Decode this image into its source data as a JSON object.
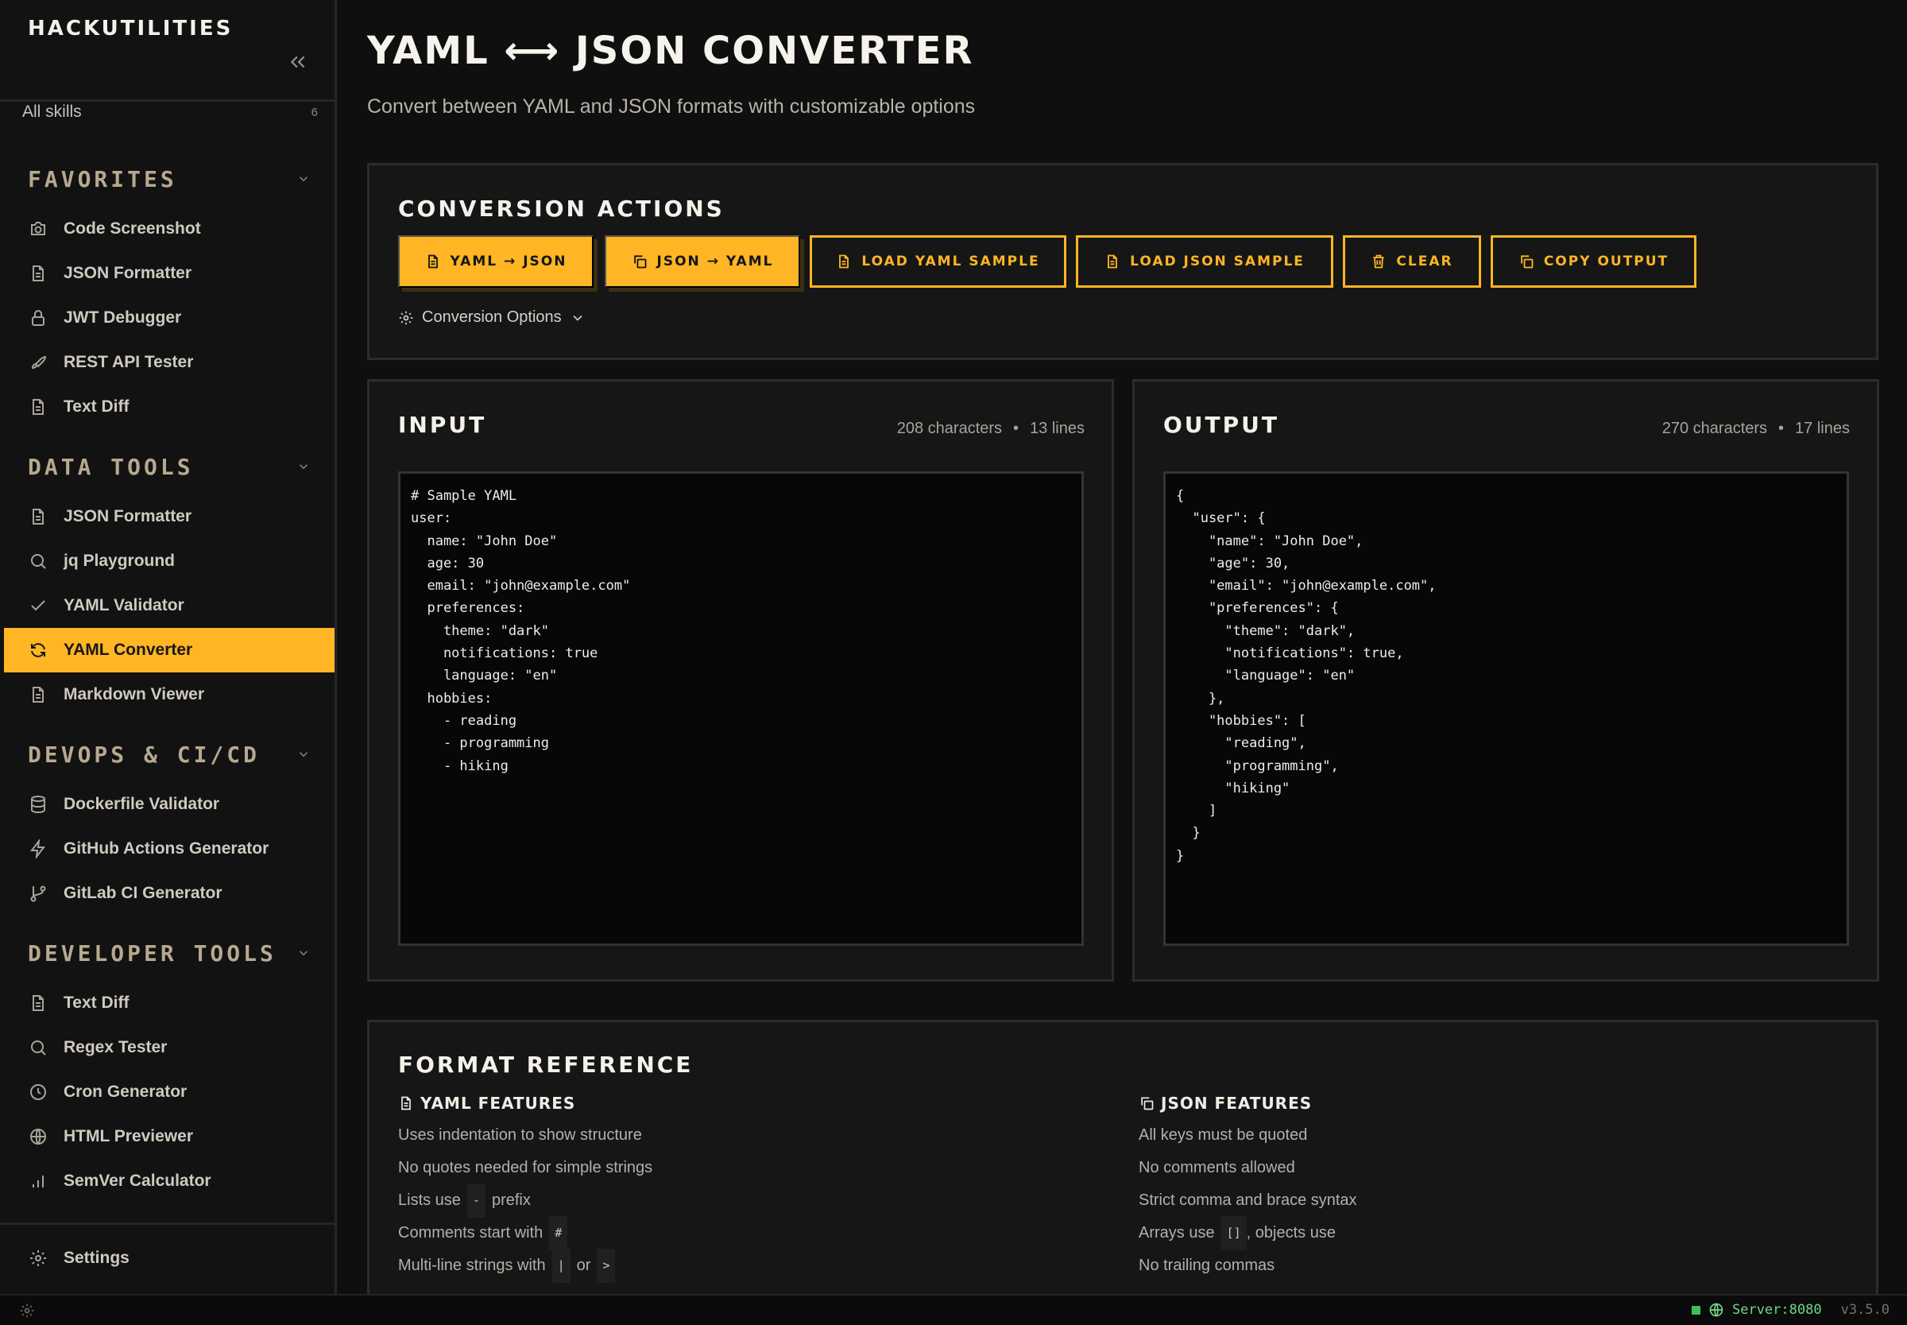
{
  "sidebar": {
    "brand": "HACKUTILITIES",
    "all_skills": {
      "label": "All skills",
      "count": "6"
    },
    "sections": [
      {
        "title": "FAVORITES",
        "items": [
          {
            "label": "Code Screenshot",
            "icon": "camera-icon"
          },
          {
            "label": "JSON Formatter",
            "icon": "document-icon"
          },
          {
            "label": "JWT Debugger",
            "icon": "lock-icon"
          },
          {
            "label": "REST API Tester",
            "icon": "rocket-icon"
          },
          {
            "label": "Text Diff",
            "icon": "document-icon"
          }
        ]
      },
      {
        "title": "DATA TOOLS",
        "items": [
          {
            "label": "JSON Formatter",
            "icon": "document-icon"
          },
          {
            "label": "jq Playground",
            "icon": "search-icon"
          },
          {
            "label": "YAML Validator",
            "icon": "check-icon"
          },
          {
            "label": "YAML Converter",
            "icon": "refresh-icon",
            "active": true
          },
          {
            "label": "Markdown Viewer",
            "icon": "document-icon"
          }
        ]
      },
      {
        "title": "DEVOPS & CI/CD",
        "items": [
          {
            "label": "Dockerfile Validator",
            "icon": "database-icon"
          },
          {
            "label": "GitHub Actions Generator",
            "icon": "lightning-icon"
          },
          {
            "label": "GitLab CI Generator",
            "icon": "git-branch-icon"
          }
        ]
      },
      {
        "title": "DEVELOPER TOOLS",
        "items": [
          {
            "label": "Text Diff",
            "icon": "document-icon"
          },
          {
            "label": "Regex Tester",
            "icon": "search-icon"
          },
          {
            "label": "Cron Generator",
            "icon": "clock-icon"
          },
          {
            "label": "HTML Previewer",
            "icon": "globe-icon"
          },
          {
            "label": "SemVer Calculator",
            "icon": "bar-chart-icon"
          }
        ]
      }
    ],
    "settings_label": "Settings"
  },
  "page": {
    "title": "YAML ⟷ JSON CONVERTER",
    "subtitle": "Convert between YAML and JSON formats with customizable options"
  },
  "actions": {
    "title": "CONVERSION ACTIONS",
    "buttons": {
      "yaml_to_json": "YAML → JSON",
      "json_to_yaml": "JSON → YAML",
      "load_yaml": "LOAD YAML SAMPLE",
      "load_json": "LOAD JSON SAMPLE",
      "clear": "CLEAR",
      "copy": "COPY OUTPUT"
    },
    "options_label": "Conversion Options"
  },
  "input": {
    "title": "INPUT",
    "characters": "208 characters",
    "lines": "13 lines",
    "content": "# Sample YAML\nuser:\n  name: \"John Doe\"\n  age: 30\n  email: \"john@example.com\"\n  preferences:\n    theme: \"dark\"\n    notifications: true\n    language: \"en\"\n  hobbies:\n    - reading\n    - programming\n    - hiking"
  },
  "output": {
    "title": "OUTPUT",
    "characters": "270 characters",
    "lines": "17 lines",
    "content": "{\n  \"user\": {\n    \"name\": \"John Doe\",\n    \"age\": 30,\n    \"email\": \"john@example.com\",\n    \"preferences\": {\n      \"theme\": \"dark\",\n      \"notifications\": true,\n      \"language\": \"en\"\n    },\n    \"hobbies\": [\n      \"reading\",\n      \"programming\",\n      \"hiking\"\n    ]\n  }\n}"
  },
  "reference": {
    "title": "FORMAT REFERENCE",
    "yaml": {
      "title": "YAML FEATURES",
      "items": [
        "Uses indentation to show structure",
        "No quotes needed for simple strings"
      ],
      "lists_prefix": "Lists use",
      "lists_code": "-",
      "lists_suffix": "prefix",
      "comments_prefix": "Comments start with",
      "comments_code": "#",
      "multiline_prefix": "Multi-line strings with",
      "multiline_code1": "|",
      "multiline_or": "or",
      "multiline_code2": ">"
    },
    "json": {
      "title": "JSON FEATURES",
      "items": [
        "All keys must be quoted",
        "No comments allowed",
        "Strict comma and brace syntax"
      ],
      "arrays_prefix": "Arrays use",
      "arrays_code": "[]",
      "arrays_suffix": ", objects use",
      "last": "No trailing commas"
    }
  },
  "status": {
    "server": "Server:8080",
    "version": "v3.5.0"
  },
  "colors": {
    "accent": "#ffb524",
    "background": "#0f0f0f",
    "panel": "#161616",
    "server_ok": "#3fbf5a"
  }
}
